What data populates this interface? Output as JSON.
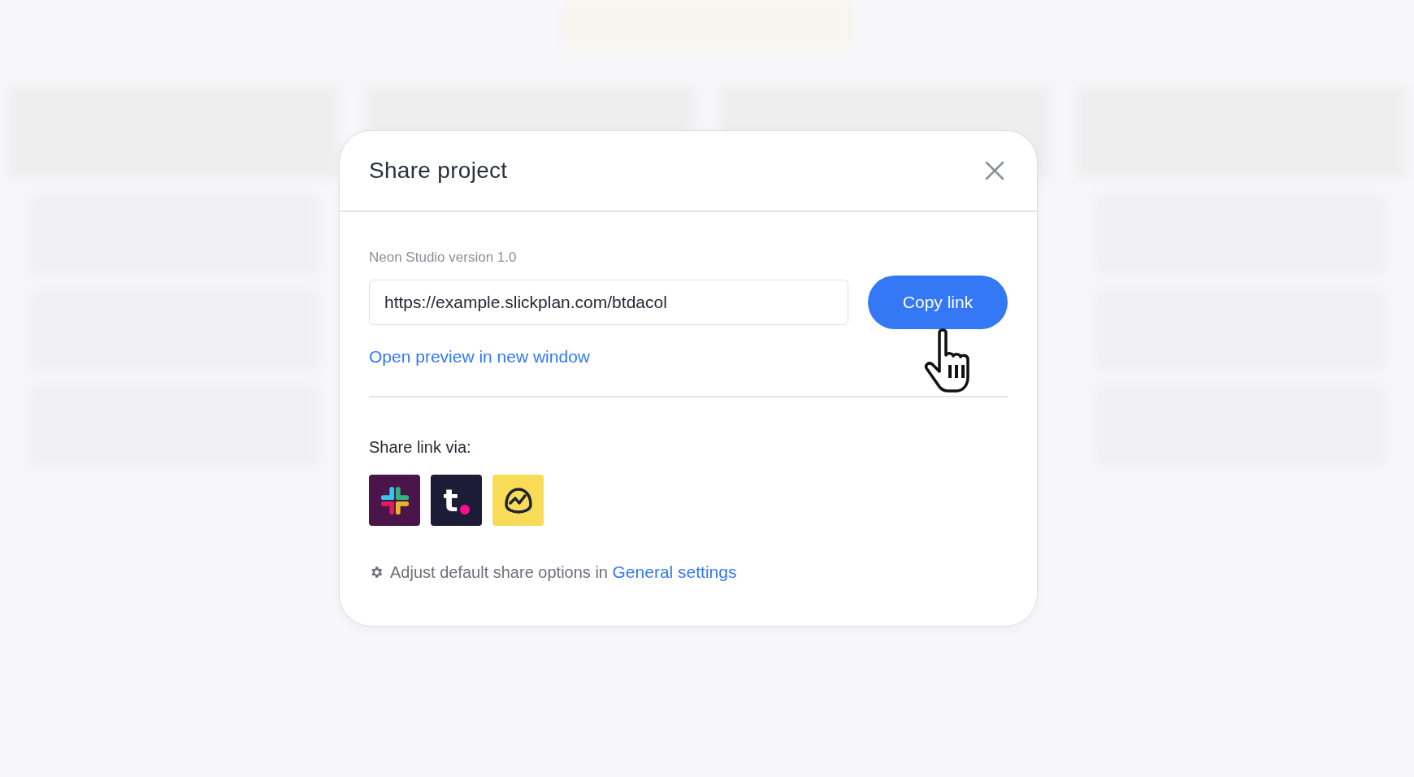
{
  "dialog": {
    "title": "Share project",
    "project_label": "Neon Studio version 1.0",
    "link_field": {
      "value": "https://example.slickplan.com/btdacol"
    },
    "copy_button": "Copy link",
    "preview_link": "Open preview in new window",
    "share_heading": "Share link via:",
    "share_services": [
      {
        "kind": "hash",
        "color": "#4a154b"
      },
      {
        "kind": "letter",
        "glyph": "t",
        "color": "#1d1c36"
      },
      {
        "kind": "wave",
        "color": "#f8dc58"
      }
    ],
    "footer": {
      "text": "Adjust default share options in ",
      "link": "General settings"
    }
  }
}
